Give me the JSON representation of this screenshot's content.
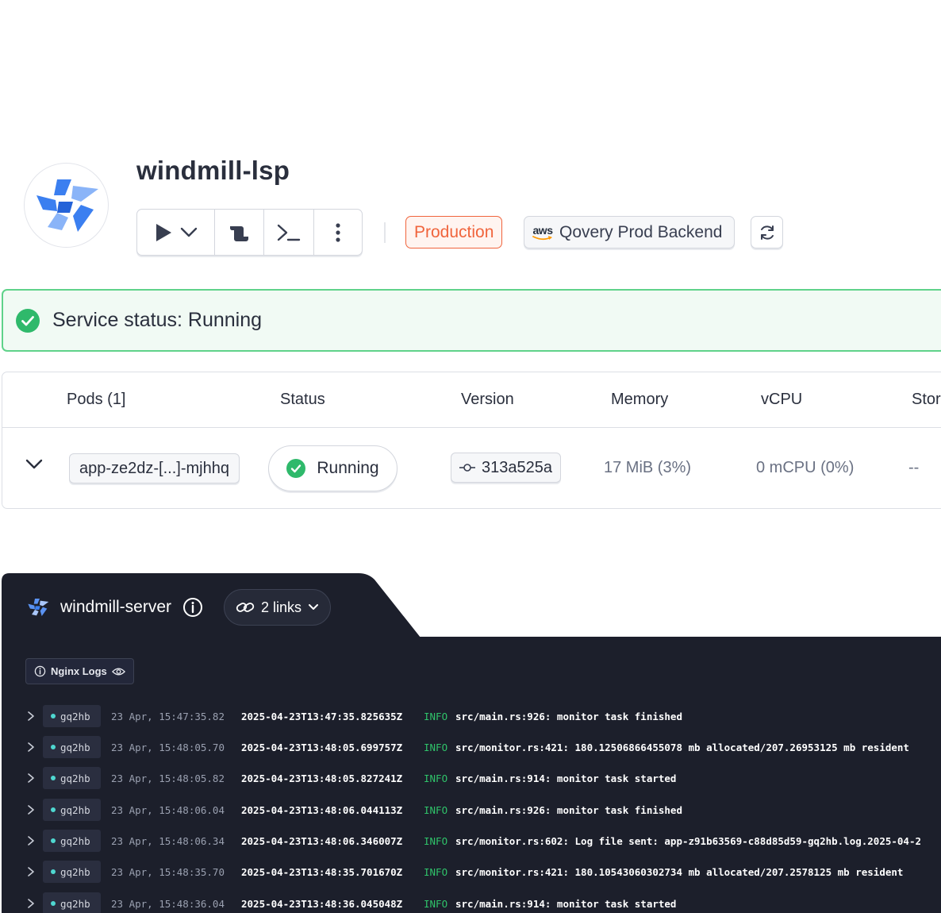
{
  "service": {
    "title": "windmill-lsp",
    "logo_icon": "windmill-logo-icon",
    "environment_badge": "Production",
    "cluster": {
      "provider_label": "aws",
      "name": "Qovery Prod Backend"
    },
    "actions": [
      "play-icon",
      "chevron-down-icon",
      "deploy-icon",
      "terminal-icon",
      "more-vertical-icon",
      "refresh-icon"
    ]
  },
  "status_banner": {
    "text": "Service status: Running",
    "icon": "check-circle-icon"
  },
  "pods_table": {
    "headers": {
      "pods": "Pods (1]",
      "status": "Status",
      "version": "Version",
      "memory": "Memory",
      "vcpu": "vCPU",
      "storage": "Stor"
    },
    "rows": [
      {
        "name": "app-ze2dz-[...]-mjhhq",
        "status": "Running",
        "version": "313a525a",
        "memory": "17 MiB (3%)",
        "vcpu": "0 mCPU (0%)",
        "storage": "--"
      }
    ]
  },
  "log_panel": {
    "service_name": "windmill-server",
    "links_label": "2 links",
    "nginx_logs_label": "Nginx Logs",
    "lines": [
      {
        "pod": "gq2hb",
        "time": "23 Apr, 15:47:35.82",
        "iso": "2025-04-23T13:47:35.825635Z",
        "level": "INFO",
        "message": "src/main.rs:926: monitor task finished"
      },
      {
        "pod": "gq2hb",
        "time": "23 Apr, 15:48:05.70",
        "iso": "2025-04-23T13:48:05.699757Z",
        "level": "INFO",
        "message": "src/monitor.rs:421: 180.12506866455078 mb allocated/207.26953125 mb resident"
      },
      {
        "pod": "gq2hb",
        "time": "23 Apr, 15:48:05.82",
        "iso": "2025-04-23T13:48:05.827241Z",
        "level": "INFO",
        "message": "src/main.rs:914: monitor task started"
      },
      {
        "pod": "gq2hb",
        "time": "23 Apr, 15:48:06.04",
        "iso": "2025-04-23T13:48:06.044113Z",
        "level": "INFO",
        "message": "src/main.rs:926: monitor task finished"
      },
      {
        "pod": "gq2hb",
        "time": "23 Apr, 15:48:06.34",
        "iso": "2025-04-23T13:48:06.346007Z",
        "level": "INFO",
        "message": "src/monitor.rs:602: Log file sent: app-z91b63569-c88d85d59-gq2hb.log.2025-04-2"
      },
      {
        "pod": "gq2hb",
        "time": "23 Apr, 15:48:35.70",
        "iso": "2025-04-23T13:48:35.701670Z",
        "level": "INFO",
        "message": "src/monitor.rs:421: 180.10543060302734 mb allocated/207.2578125 mb resident"
      },
      {
        "pod": "gq2hb",
        "time": "23 Apr, 15:48:36.04",
        "iso": "2025-04-23T13:48:36.045048Z",
        "level": "INFO",
        "message": "src/main.rs:914: monitor task started"
      }
    ]
  },
  "colors": {
    "production": "#f0643c",
    "running_green": "#2fb96b",
    "logo_blue": "#3b7ff0",
    "log_bg": "#1c1f2b",
    "info_level": "#2fc36a",
    "pod_dot": "#4fd7d0"
  }
}
